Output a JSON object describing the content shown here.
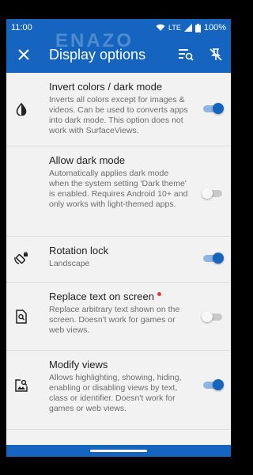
{
  "status": {
    "time": "11:00",
    "network": "LTE",
    "battery": "100%"
  },
  "appbar": {
    "title": "Display options"
  },
  "watermark": "ENAZO",
  "items": [
    {
      "title": "Invert colors / dark mode",
      "desc": "Inverts all colors except for images & videos. Can be used to converts apps into dark mode. This option does not work with SurfaceViews.",
      "enabled": true
    },
    {
      "title": "Allow dark mode",
      "desc": "Automatically applies dark mode when the system setting 'Dark theme' is enabled. Requires Android 10+ and only works with light-themed apps.",
      "enabled": false
    },
    {
      "title": "Rotation lock",
      "desc": "Landscape",
      "enabled": true
    },
    {
      "title": "Replace text on screen",
      "desc": "Replace arbitrary text shown on the screen. Doesn't work for games or web views.",
      "enabled": false
    },
    {
      "title": "Modify views",
      "desc": "Allows highlighting, showing, hiding, enabling or disabling views by text, class or identifier. Doesn't work for games or web views.",
      "enabled": true
    }
  ],
  "colors": {
    "primary": "#1565c0",
    "switch_on": "#1565c0",
    "switch_off": "#f7f7f7",
    "new_dot": "#e53935"
  }
}
